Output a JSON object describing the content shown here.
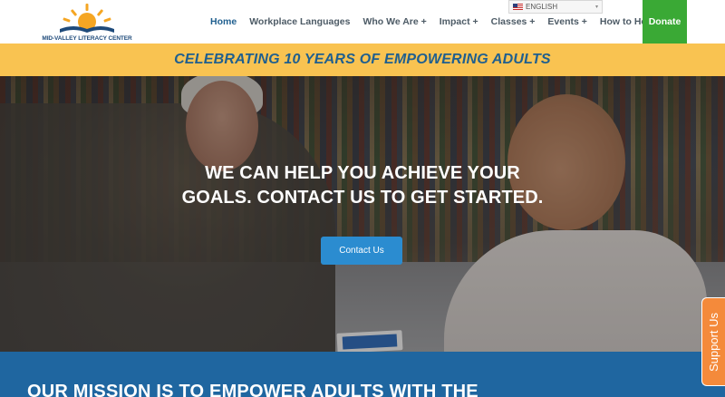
{
  "header": {
    "logo_text": "MID-VALLEY LITERACY CENTER",
    "nav": [
      {
        "label": "Home",
        "active": true
      },
      {
        "label": "Workplace Languages",
        "active": false
      },
      {
        "label": "Who We Are +",
        "active": false
      },
      {
        "label": "Impact +",
        "active": false
      },
      {
        "label": "Classes +",
        "active": false
      },
      {
        "label": "Events +",
        "active": false
      },
      {
        "label": "How to Help +",
        "active": false
      }
    ],
    "donate_label": "Donate",
    "language": {
      "label": "ENGLISH",
      "flag": "us-flag-icon"
    }
  },
  "banner": {
    "text": "CELEBRATING 10 YEARS OF EMPOWERING ADULTS"
  },
  "hero": {
    "headline_line1": "WE CAN HELP YOU ACHIEVE YOUR",
    "headline_line2": "GOALS. CONTACT US TO GET STARTED.",
    "cta_label": "Contact Us"
  },
  "mission": {
    "text": "OUR MISSION IS TO EMPOWER ADULTS WITH THE"
  },
  "support_tab": {
    "label": "Support Us"
  },
  "colors": {
    "brand_blue": "#1f66a0",
    "banner_yellow": "#f9c351",
    "donate_green": "#3aa935",
    "cta_blue": "#2b8cd0",
    "support_orange": "#f48a3b"
  }
}
